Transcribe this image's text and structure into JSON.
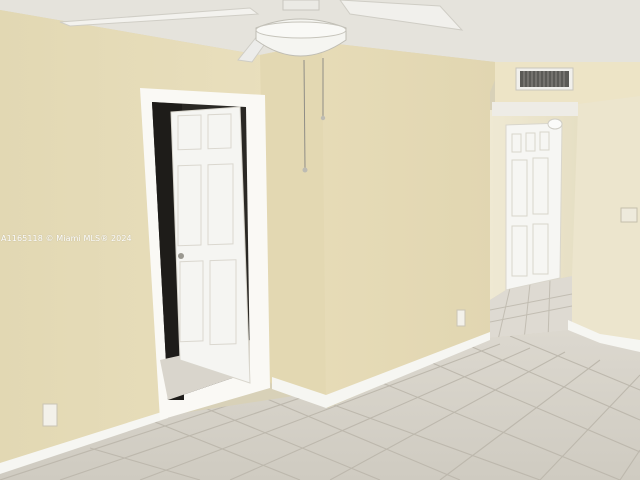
{
  "photo": {
    "watermark": "A1165118 © Miami MLS® 2024",
    "subject": "empty room with tiled floor",
    "colors": {
      "wall": "#e6dcb8",
      "ceiling": "#e4e2db",
      "floor_tile": "#d4d0c6",
      "grout": "#bdb8ad",
      "door": "#f4f4f2",
      "baseboard": "#f7f7f4"
    }
  }
}
